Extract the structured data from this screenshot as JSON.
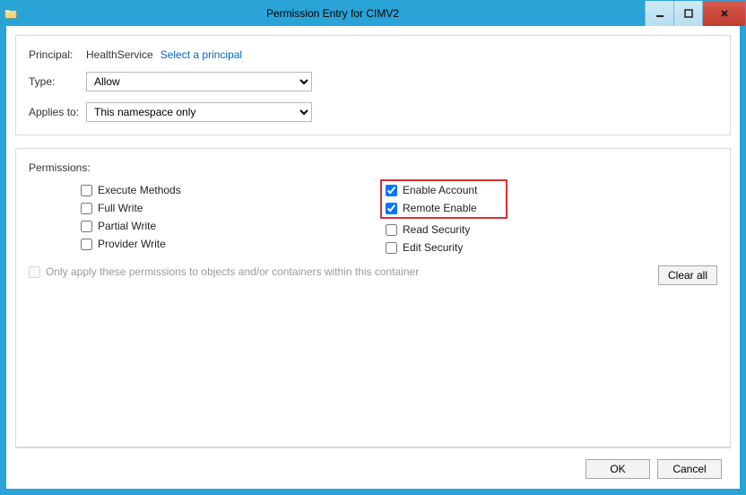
{
  "window": {
    "title": "Permission Entry for CIMV2"
  },
  "fields": {
    "principal_label": "Principal:",
    "principal_value": "HealthService",
    "principal_link": "Select a principal",
    "type_label": "Type:",
    "type_value": "Allow",
    "applies_label": "Applies to:",
    "applies_value": "This namespace only"
  },
  "permissions": {
    "header": "Permissions:",
    "left": [
      {
        "label": "Execute Methods",
        "checked": false
      },
      {
        "label": "Full Write",
        "checked": false
      },
      {
        "label": "Partial Write",
        "checked": false
      },
      {
        "label": "Provider Write",
        "checked": false
      }
    ],
    "right": [
      {
        "label": "Enable Account",
        "checked": true
      },
      {
        "label": "Remote Enable",
        "checked": true
      },
      {
        "label": "Read Security",
        "checked": false
      },
      {
        "label": "Edit Security",
        "checked": false
      }
    ]
  },
  "only_apply": "Only apply these permissions to objects and/or containers within this container",
  "buttons": {
    "clear_all": "Clear all",
    "ok": "OK",
    "cancel": "Cancel"
  }
}
